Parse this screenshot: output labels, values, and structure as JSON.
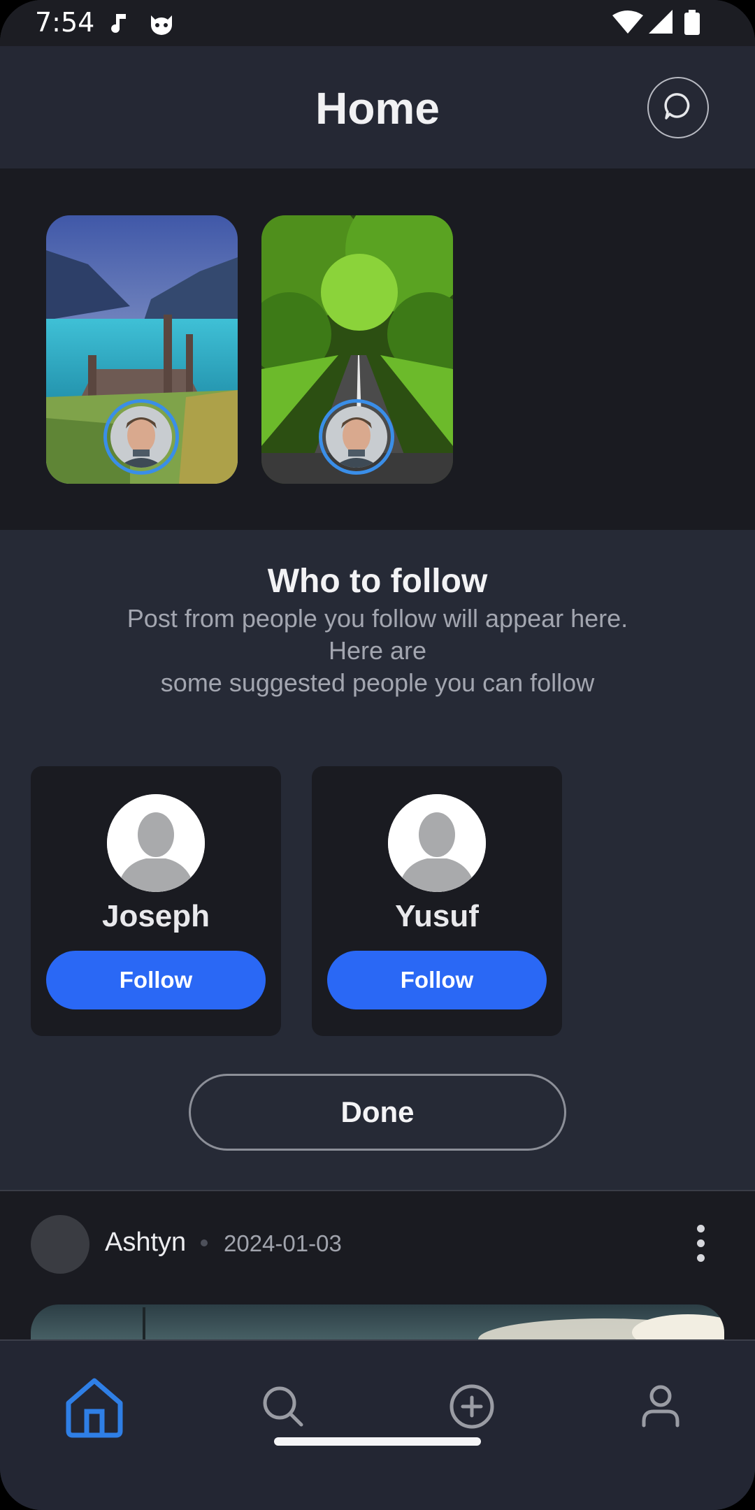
{
  "status_bar": {
    "time": "7:54",
    "icons": [
      "music-note-icon",
      "cat-face-icon",
      "wifi-icon",
      "signal-icon",
      "battery-icon"
    ]
  },
  "header": {
    "title": "Home",
    "chat_icon": "chat-bubble-icon"
  },
  "stories": [
    {
      "scene": "lake-pier",
      "avatar": "user-avatar"
    },
    {
      "scene": "tree-road",
      "avatar": "user-avatar"
    }
  ],
  "who_to_follow": {
    "title": "Who to follow",
    "description": "Post from people you follow will appear here.\nHere are\nsome suggested people you can follow",
    "people": [
      {
        "name": "Joseph",
        "follow_label": "Follow"
      },
      {
        "name": "Yusuf",
        "follow_label": "Follow"
      }
    ],
    "done_label": "Done"
  },
  "post": {
    "author": "Ashtyn",
    "date": "2024-01-03"
  },
  "bottom_nav": {
    "items": [
      {
        "name": "home",
        "icon": "home-icon",
        "active": true
      },
      {
        "name": "search",
        "icon": "search-icon",
        "active": false
      },
      {
        "name": "create",
        "icon": "plus-circle-icon",
        "active": false
      },
      {
        "name": "profile",
        "icon": "person-icon",
        "active": false
      }
    ]
  },
  "colors": {
    "accent": "#2a68f5",
    "nav_active": "#2f7fe6",
    "story_ring": "#3a8ee8",
    "background": "#262a36",
    "card": "#1a1b21"
  }
}
